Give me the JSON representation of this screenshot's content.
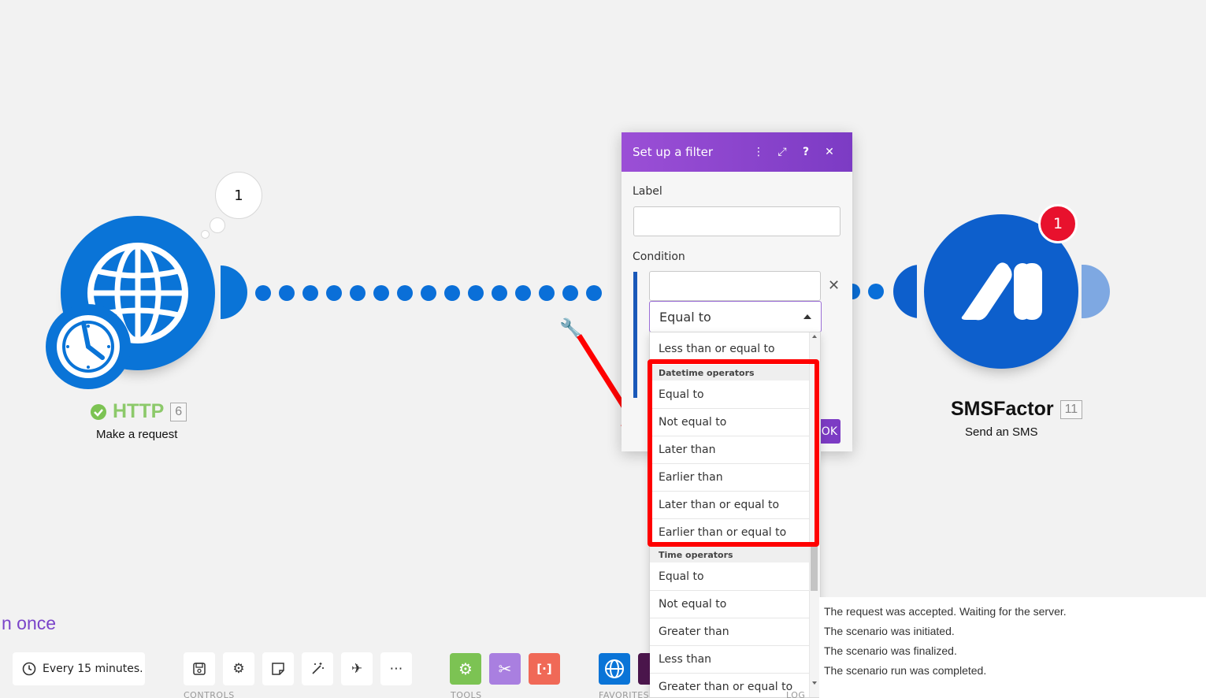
{
  "canvas": {
    "http_module": {
      "name": "HTTP",
      "id": "6",
      "action": "Make a request",
      "bubble_count": "1",
      "color": "#0a74d7",
      "name_color": "#7cc353",
      "status_icon": "check-circle-icon",
      "icon": "globe-icon",
      "trigger_icon": "clock-icon"
    },
    "sms_module": {
      "name": "SMSFactor",
      "id": "11",
      "action": "Send an SMS",
      "badge_count": "1",
      "color": "#0d5fcc",
      "badge_color": "#e8112d"
    },
    "connector_icon": "wrench-icon",
    "annotation_arrow_color": "#ff0000"
  },
  "filter_dialog": {
    "title": "Set up a filter",
    "header_buttons": [
      "more-vertical-icon",
      "expand-icon",
      "help-icon",
      "close-icon"
    ],
    "label_field_label": "Label",
    "label_value": "",
    "condition_label": "Condition",
    "condition_value": "",
    "operator_selected": "Equal to",
    "ok_label": "OK",
    "accent": "#7c3bc4"
  },
  "operator_dropdown": {
    "top_item": "Less than or equal to",
    "groups": [
      {
        "label": "Datetime operators",
        "items": [
          "Equal to",
          "Not equal to",
          "Later than",
          "Earlier than",
          "Later than or equal to",
          "Earlier than or equal to"
        ]
      },
      {
        "label": "Time operators",
        "items": [
          "Equal to",
          "Not equal to",
          "Greater than",
          "Less than",
          "Greater than or equal to"
        ]
      }
    ]
  },
  "bottom_bar": {
    "run_once": "n once",
    "schedule": "Every 15 minutes.",
    "controls_label": "CONTROLS",
    "tools_label": "TOOLS",
    "favorites_label": "FAVORITES",
    "log_label": "LOG",
    "control_icons": [
      "save-icon",
      "gear-icon",
      "note-icon",
      "magic-wand-icon",
      "airplane-icon",
      "more-icon"
    ],
    "tool_icons": [
      "settings-tool-icon",
      "tools-icon",
      "text-parser-icon"
    ],
    "favorite_icons": [
      "http-globe-icon",
      "slack-icon"
    ]
  },
  "log": {
    "lines": [
      "The request was accepted. Waiting for the server.",
      "The scenario was initiated.",
      "The scenario was finalized.",
      "The scenario run was completed."
    ]
  }
}
